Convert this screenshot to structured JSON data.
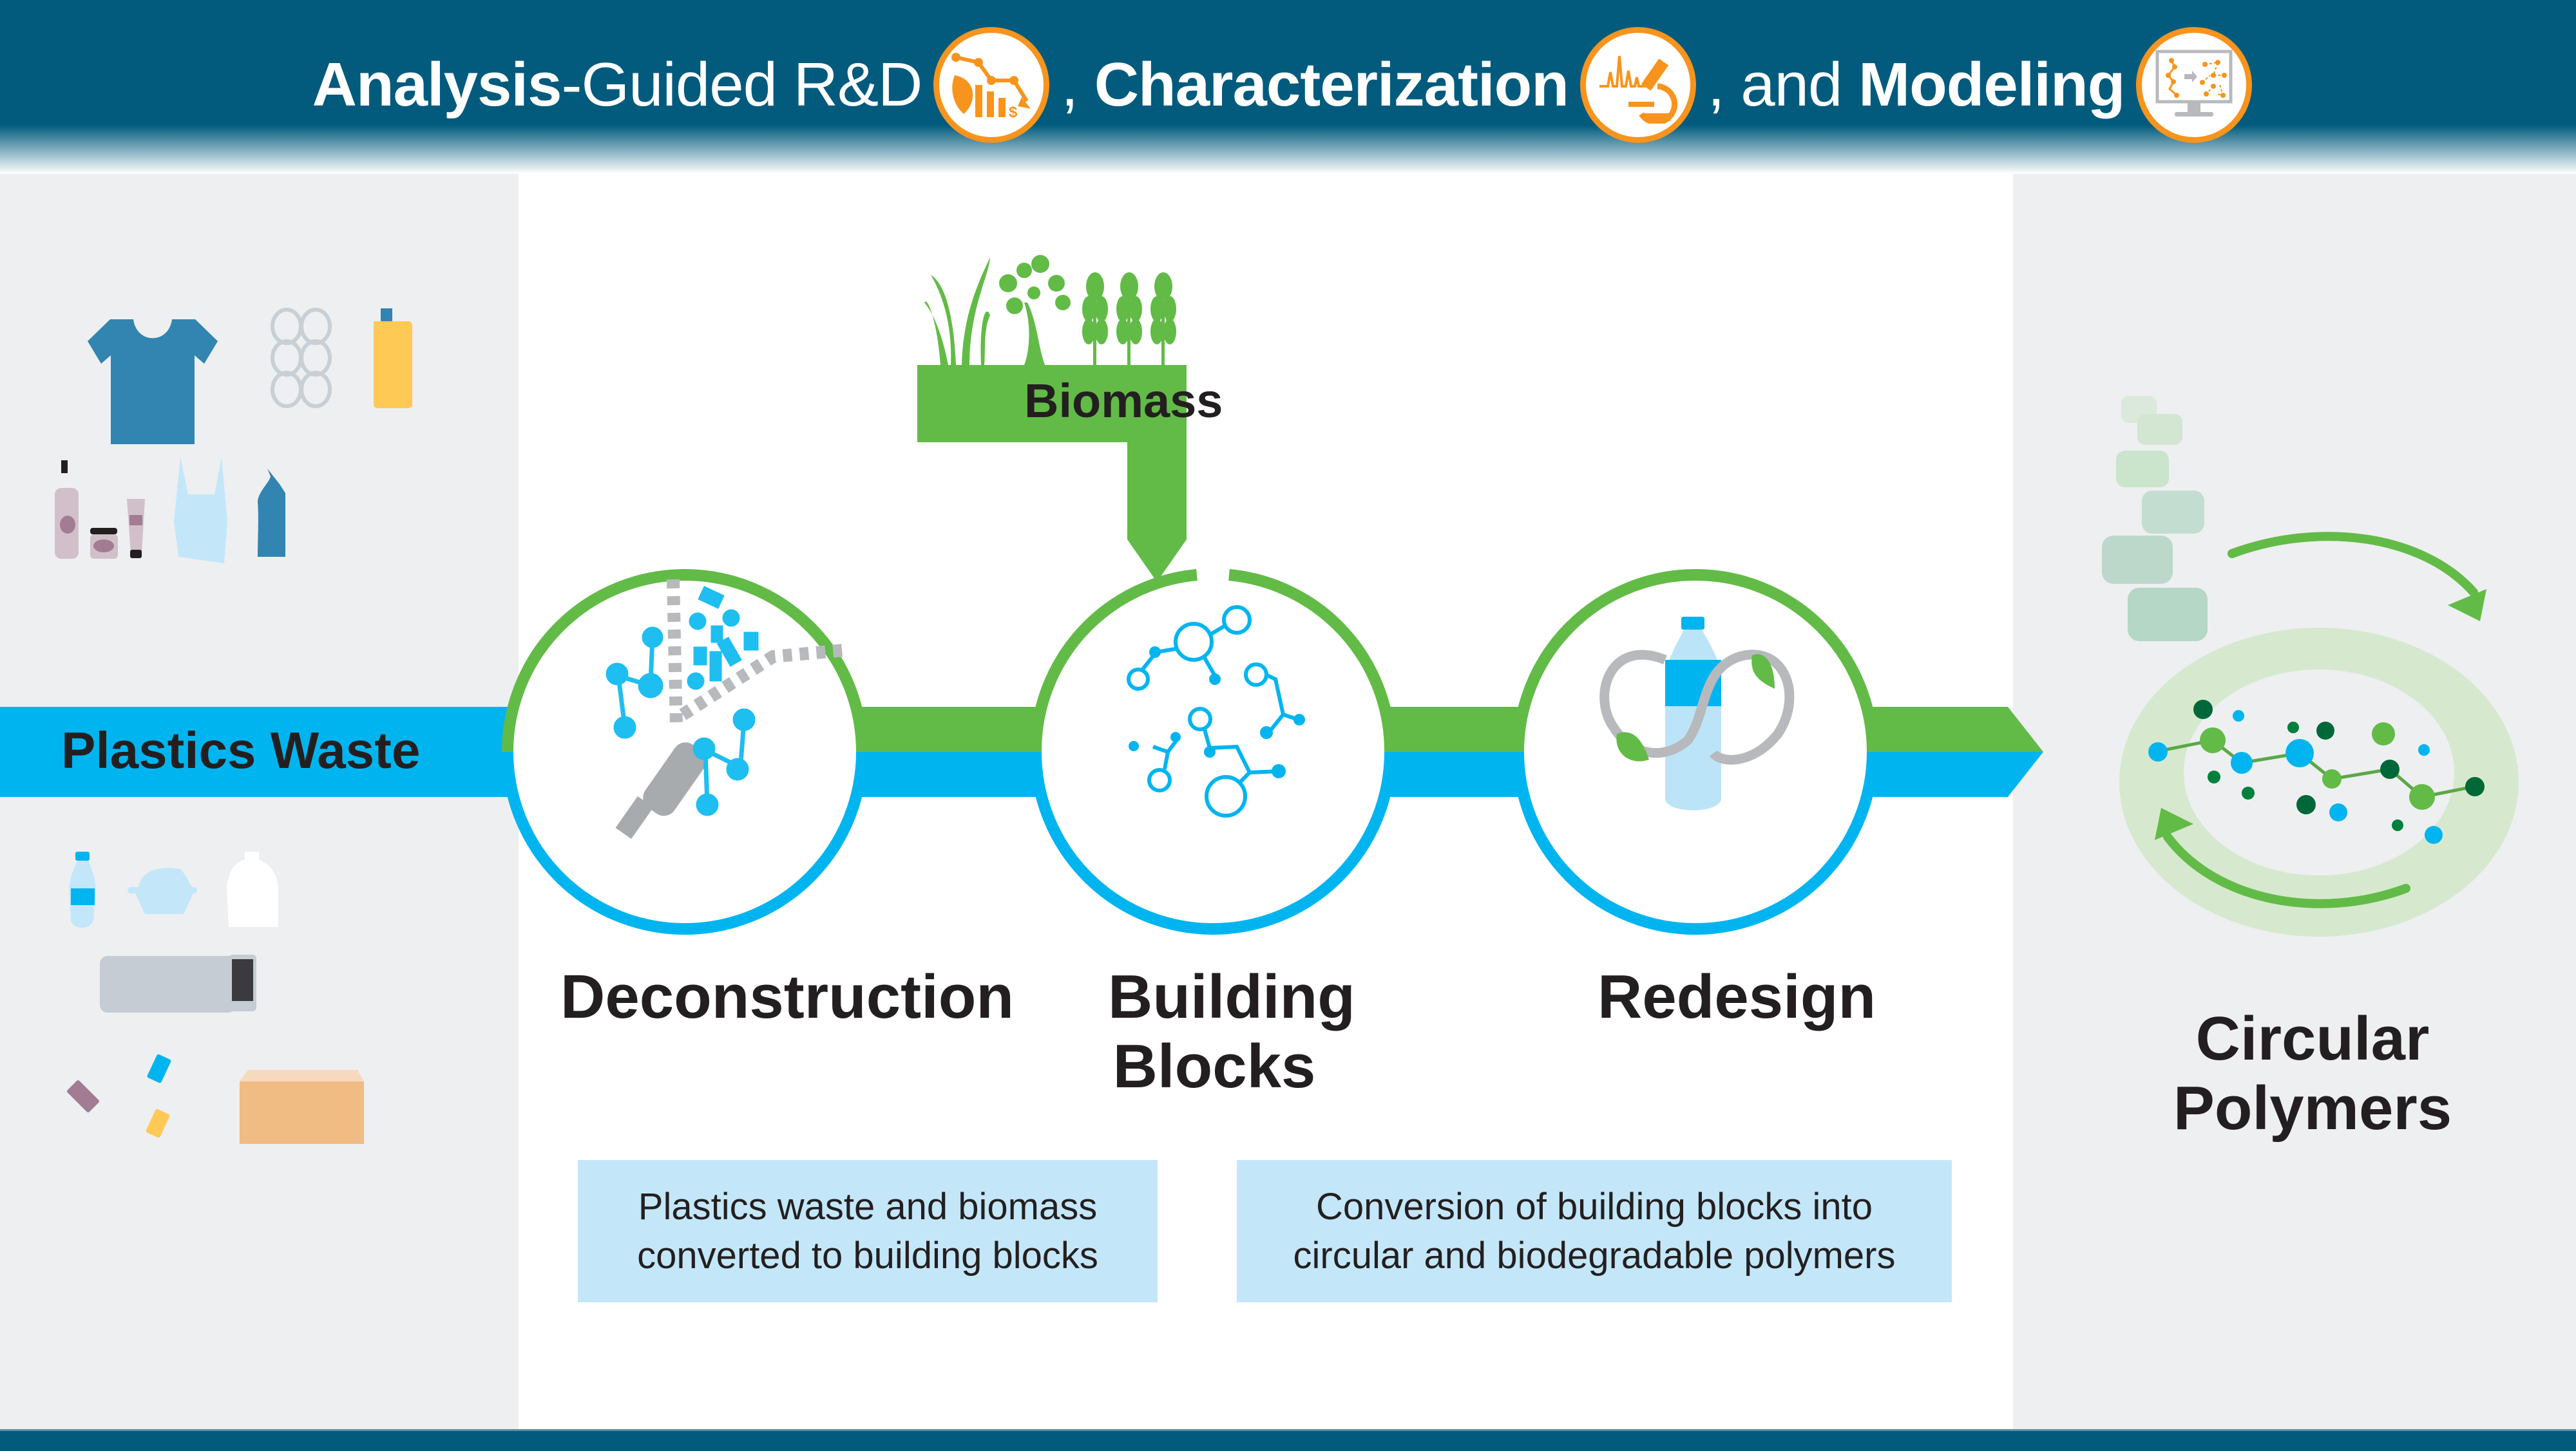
{
  "header": {
    "title_parts": {
      "analysis_bold": "Analysis",
      "analysis_rest": "-Guided R&D",
      "comma1": ",",
      "characterization": "Characterization",
      "comma2": ", and",
      "modeling": "Modeling"
    },
    "icons": [
      "analysis-chart-leaf-icon",
      "spectrum-microscope-icon",
      "monitor-molecule-model-icon"
    ],
    "accent_color": "#f7941d",
    "background_color": "#025b7d"
  },
  "plastics_waste": {
    "label": "Plastics Waste",
    "items": [
      "t-shirt",
      "six-pack-rings",
      "detergent-bottle",
      "pump-bottle",
      "cosmetic-jar",
      "cream-tube",
      "plastic-bag",
      "cleaner-bottle",
      "water-bottle",
      "clamshell-container",
      "milk-jug",
      "keyboard",
      "cracked-phone",
      "candy-wrappers",
      "packing-box-peanuts"
    ]
  },
  "biomass": {
    "label": "Biomass",
    "items": [
      "grass",
      "tree",
      "wheat",
      "wheat",
      "wheat"
    ],
    "color": "#62bb46"
  },
  "stages": [
    {
      "id": "deconstruction",
      "label": "Deconstruction"
    },
    {
      "id": "building-blocks",
      "label_line1": "Building",
      "label_line2": "Blocks"
    },
    {
      "id": "redesign",
      "label": "Redesign"
    }
  ],
  "outcome": {
    "label_line1": "Circular",
    "label_line2": "Polymers"
  },
  "descriptions": [
    {
      "line1": "Plastics waste and biomass",
      "line2": "converted to building blocks"
    },
    {
      "line1": "Conversion of building blocks into",
      "line2": "circular and biodegradable polymers"
    }
  ],
  "colors": {
    "flow_blue": "#00b5ef",
    "flow_green": "#62bb46",
    "desc_box": "#c3e7f9",
    "panel_gray": "#eeeff1"
  }
}
